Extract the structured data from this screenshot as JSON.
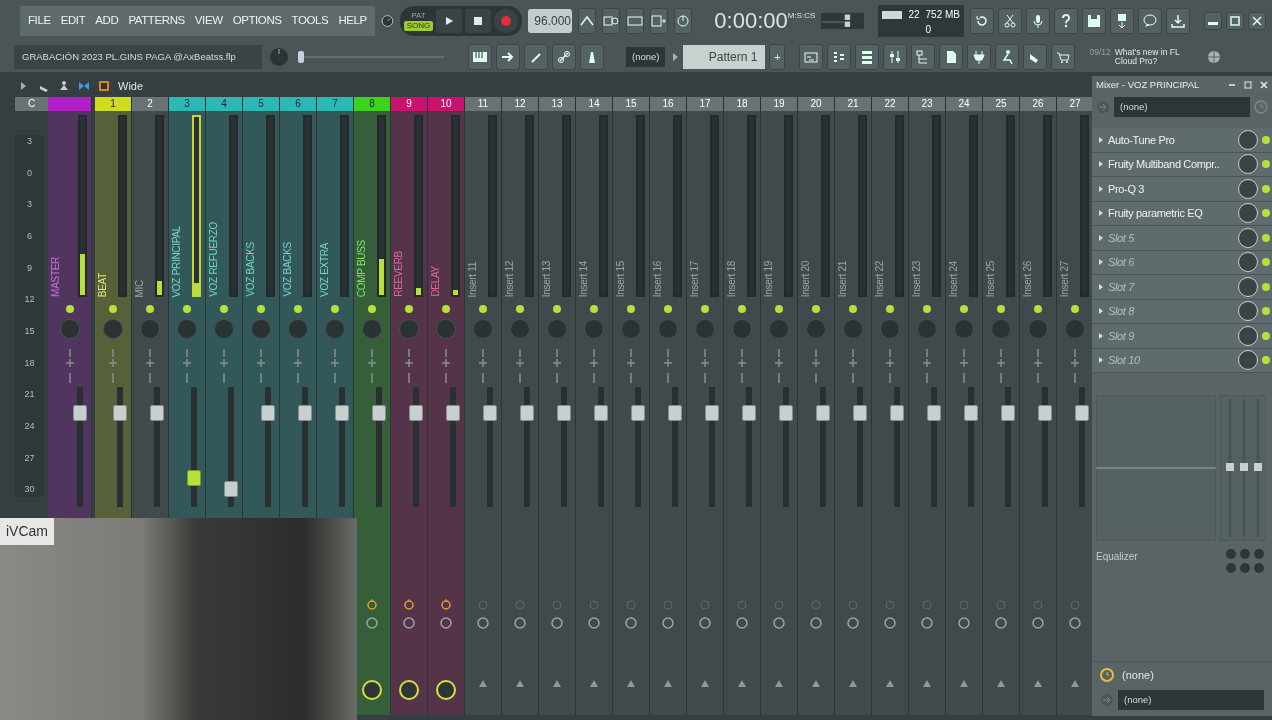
{
  "menu": [
    "FILE",
    "EDIT",
    "ADD",
    "PATTERNS",
    "VIEW",
    "OPTIONS",
    "TOOLS",
    "HELP"
  ],
  "transport": {
    "modes": [
      {
        "label": "PAT",
        "selected": false
      },
      {
        "label": "SONG",
        "selected": true
      }
    ]
  },
  "tempo": "96.000",
  "time": {
    "value": "0:00:00",
    "unit": "M:S:CS"
  },
  "monitor": {
    "cpu": "22",
    "memory": "752 MB",
    "polyphony": "0"
  },
  "project_title": "GRABACIÓN 2023 PL.GINS PAGA @AxBeatss.flp",
  "pattern_picker": {
    "value": "(none)"
  },
  "pattern": {
    "name": "Pattern 1",
    "add": "+"
  },
  "news": {
    "date": "09/12",
    "headline": "What's new in FL Cloud Pro?"
  },
  "mixer": {
    "view": "Wide",
    "scale_header": "C",
    "scale": [
      "3",
      "0",
      "3",
      "6",
      "9",
      "12",
      "15",
      "18",
      "21",
      "24",
      "27",
      "30"
    ],
    "strips": [
      {
        "name": "MASTER",
        "color": "#b41ec8",
        "selected": false,
        "meter": {
          "level": 0.23
        },
        "fader": {
          "level": 0.83
        }
      },
      {
        "number": "1",
        "name": "BEAT",
        "color": "#cfdc1e",
        "selected": false,
        "meter": {
          "level": 0
        },
        "fader": {
          "level": 0.83
        }
      },
      {
        "number": "2",
        "name": "MIC",
        "color": "#6a7276",
        "selected": false,
        "meter": {
          "level": 0.08
        },
        "fader": {
          "level": 0.83
        }
      },
      {
        "number": "3",
        "name": "VOZ PRINCIPAL",
        "color": "#2ab9b4",
        "selected": true,
        "meter": {
          "level": 0.07
        },
        "fader": {
          "level": 0.2
        }
      },
      {
        "number": "4",
        "name": "VOZ REFUERZO",
        "color": "#2ab9b4",
        "selected": false,
        "meter": {
          "level": 0
        },
        "fader": {
          "level": 0.1
        }
      },
      {
        "number": "5",
        "name": "VOZ BACKS",
        "color": "#2ab9b4",
        "selected": false,
        "meter": {
          "level": 0
        },
        "fader": {
          "level": 0.83
        }
      },
      {
        "number": "6",
        "name": "VOZ BACKS",
        "color": "#2ab9b4",
        "selected": false,
        "meter": {
          "level": 0
        },
        "fader": {
          "level": 0.83
        }
      },
      {
        "number": "7",
        "name": "VOZ EXTRA",
        "color": "#2ab9b4",
        "selected": false,
        "meter": {
          "level": 0
        },
        "fader": {
          "level": 0.83
        }
      },
      {
        "number": "8",
        "name": "COMP BUSS",
        "color": "#3cd21e",
        "selected": false,
        "meter": {
          "level": 0.2
        },
        "fader": {
          "level": 0.83
        },
        "send": true
      },
      {
        "number": "9",
        "name": "REEVERB",
        "color": "#c8146e",
        "selected": false,
        "meter": {
          "level": 0.04
        },
        "fader": {
          "level": 0.83
        },
        "send": true
      },
      {
        "number": "10",
        "name": "DELAY",
        "color": "#c8146e",
        "selected": false,
        "meter": {
          "level": 0.03
        },
        "fader": {
          "level": 0.83
        },
        "send": true
      },
      {
        "number": "11",
        "name": "Insert 11",
        "color": "#6a7276",
        "selected": false,
        "meter": {
          "level": 0
        },
        "fader": {
          "level": 0.83
        },
        "send": false
      },
      {
        "number": "12",
        "name": "Insert 12",
        "color": "#6a7276",
        "selected": false,
        "meter": {
          "level": 0
        },
        "fader": {
          "level": 0.83
        },
        "send": false
      },
      {
        "number": "13",
        "name": "Insert 13",
        "color": "#6a7276",
        "selected": false,
        "meter": {
          "level": 0
        },
        "fader": {
          "level": 0.83
        },
        "send": false
      },
      {
        "number": "14",
        "name": "Insert 14",
        "color": "#6a7276",
        "selected": false,
        "meter": {
          "level": 0
        },
        "fader": {
          "level": 0.83
        },
        "send": false
      },
      {
        "number": "15",
        "name": "Insert 15",
        "color": "#6a7276",
        "selected": false,
        "meter": {
          "level": 0
        },
        "fader": {
          "level": 0.83
        },
        "send": false
      },
      {
        "number": "16",
        "name": "Insert 16",
        "color": "#6a7276",
        "selected": false,
        "meter": {
          "level": 0
        },
        "fader": {
          "level": 0.83
        },
        "send": false
      },
      {
        "number": "17",
        "name": "Insert 17",
        "color": "#6a7276",
        "selected": false,
        "meter": {
          "level": 0
        },
        "fader": {
          "level": 0.83
        },
        "send": false
      },
      {
        "number": "18",
        "name": "Insert 18",
        "color": "#6a7276",
        "selected": false,
        "meter": {
          "level": 0
        },
        "fader": {
          "level": 0.83
        },
        "send": false
      },
      {
        "number": "19",
        "name": "Insert 19",
        "color": "#6a7276",
        "selected": false,
        "meter": {
          "level": 0
        },
        "fader": {
          "level": 0.83
        },
        "send": false
      },
      {
        "number": "20",
        "name": "Insert 20",
        "color": "#6a7276",
        "selected": false,
        "meter": {
          "level": 0
        },
        "fader": {
          "level": 0.83
        },
        "send": false
      },
      {
        "number": "21",
        "name": "Insert 21",
        "color": "#6a7276",
        "selected": false,
        "meter": {
          "level": 0
        },
        "fader": {
          "level": 0.83
        },
        "send": false
      },
      {
        "number": "22",
        "name": "Insert 22",
        "color": "#6a7276",
        "selected": false,
        "meter": {
          "level": 0
        },
        "fader": {
          "level": 0.83
        },
        "send": false
      },
      {
        "number": "23",
        "name": "Insert 23",
        "color": "#6a7276",
        "selected": false,
        "meter": {
          "level": 0
        },
        "fader": {
          "level": 0.83
        },
        "send": false
      },
      {
        "number": "24",
        "name": "Insert 24",
        "color": "#6a7276",
        "selected": false,
        "meter": {
          "level": 0
        },
        "fader": {
          "level": 0.83
        },
        "send": false
      },
      {
        "number": "25",
        "name": "Insert 25",
        "color": "#6a7276",
        "selected": false,
        "meter": {
          "level": 0
        },
        "fader": {
          "level": 0.83
        },
        "send": false
      },
      {
        "number": "26",
        "name": "Insert 26",
        "color": "#6a7276",
        "selected": false,
        "meter": {
          "level": 0
        },
        "fader": {
          "level": 0.83
        },
        "send": false
      },
      {
        "number": "27",
        "name": "Insert 27",
        "color": "#6a7276",
        "selected": false,
        "meter": {
          "level": 0
        },
        "fader": {
          "level": 0.83
        },
        "send": false
      }
    ]
  },
  "mixer_panel": {
    "title": "Mixer - VOZ PRINCIPAL",
    "input": "(none)",
    "slots": [
      {
        "name": "Auto-Tune Pro",
        "empty": false,
        "enabled": true
      },
      {
        "name": "Fruity Multiband Compr..",
        "empty": false,
        "enabled": true
      },
      {
        "name": "Pro-Q 3",
        "empty": false,
        "enabled": true
      },
      {
        "name": "Fruity parametric EQ",
        "empty": false,
        "enabled": true
      },
      {
        "name": "Slot 5",
        "empty": true,
        "enabled": true
      },
      {
        "name": "Slot 6",
        "empty": true,
        "enabled": true
      },
      {
        "name": "Slot 7",
        "empty": true,
        "enabled": true
      },
      {
        "name": "Slot 8",
        "empty": true,
        "enabled": true
      },
      {
        "name": "Slot 9",
        "empty": true,
        "enabled": true
      },
      {
        "name": "Slot 10",
        "empty": true,
        "enabled": true
      }
    ],
    "eq_label": "Equalizer",
    "latency": "(none)",
    "output": "(none)"
  },
  "webcam": {
    "label": "iVCam"
  }
}
